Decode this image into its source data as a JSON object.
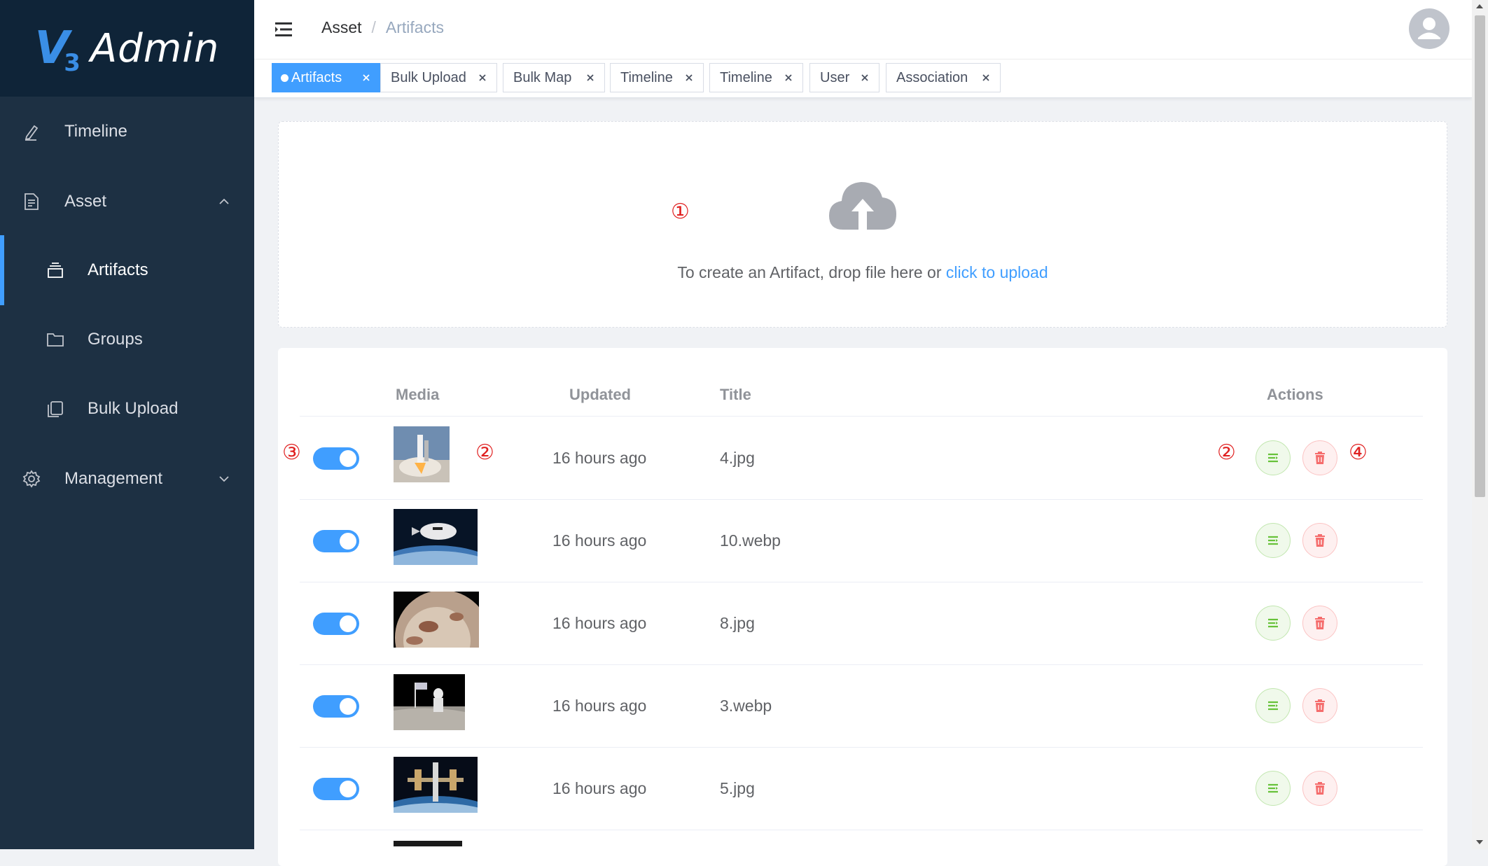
{
  "app": {
    "logo_text": "Admin",
    "logo_mark": "V",
    "logo_mark_sub": "3"
  },
  "sidebar": {
    "items": [
      {
        "label": "Timeline",
        "icon": "pen-icon"
      },
      {
        "label": "Asset",
        "icon": "document-icon",
        "expanded": true
      },
      {
        "label": "Artifacts",
        "icon": "stack-icon",
        "active": true
      },
      {
        "label": "Groups",
        "icon": "folder-icon"
      },
      {
        "label": "Bulk Upload",
        "icon": "copy-icon"
      },
      {
        "label": "Management",
        "icon": "gear-icon",
        "expanded": false
      }
    ]
  },
  "header": {
    "breadcrumb": [
      "Asset",
      "Artifacts"
    ],
    "separator": "/"
  },
  "tags": [
    {
      "label": "Artifacts",
      "active": true
    },
    {
      "label": "Bulk Upload"
    },
    {
      "label": "Bulk Map"
    },
    {
      "label": "Timeline"
    },
    {
      "label": "Timeline"
    },
    {
      "label": "User"
    },
    {
      "label": "Association"
    }
  ],
  "upload": {
    "text": "To create an Artifact, drop file here or ",
    "link": "click to upload"
  },
  "annotations": {
    "a1": "①",
    "a2": "②",
    "a3": "③",
    "a4": "④"
  },
  "table": {
    "columns": {
      "media": "Media",
      "updated": "Updated",
      "title": "Title",
      "actions": "Actions"
    },
    "rows": [
      {
        "updated": "16 hours ago",
        "title": "4.jpg",
        "enabled": true,
        "media": "rocket launch"
      },
      {
        "updated": "16 hours ago",
        "title": "10.webp",
        "enabled": true,
        "media": "capsule over earth"
      },
      {
        "updated": "16 hours ago",
        "title": "8.jpg",
        "enabled": true,
        "media": "planet surface"
      },
      {
        "updated": "16 hours ago",
        "title": "3.webp",
        "enabled": true,
        "media": "moon landing"
      },
      {
        "updated": "16 hours ago",
        "title": "5.jpg",
        "enabled": true,
        "media": "space station"
      }
    ]
  },
  "colors": {
    "sidebar_bg": "#1d3043",
    "logo_bg": "#0f2438",
    "primary": "#409eff",
    "success": "#67c23a",
    "danger": "#f56c6c",
    "annotation": "#e02020"
  }
}
